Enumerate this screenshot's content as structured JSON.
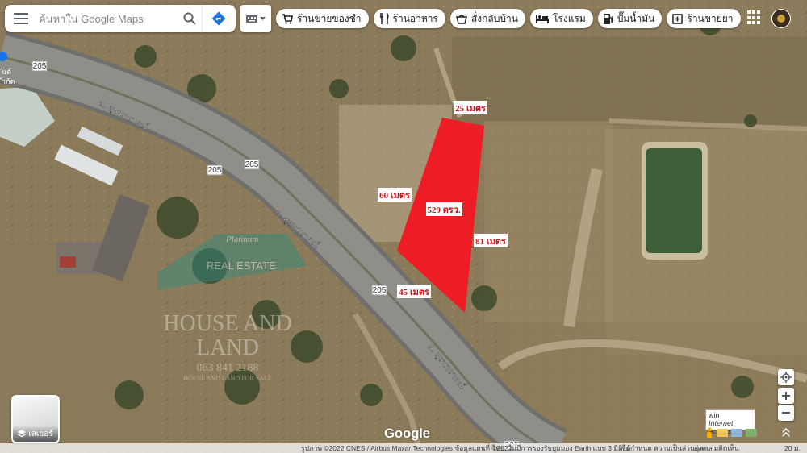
{
  "search": {
    "placeholder": "ค้นหาใน Google Maps"
  },
  "chips": [
    {
      "label": "ร้านขายของชำ",
      "icon": "cart-icon"
    },
    {
      "label": "ร้านอาหาร",
      "icon": "utensils-icon"
    },
    {
      "label": "สั่งกลับบ้าน",
      "icon": "takeout-icon"
    },
    {
      "label": "โรงแรม",
      "icon": "bed-icon"
    },
    {
      "label": "ปั๊มน้ำมัน",
      "icon": "gas-icon"
    },
    {
      "label": "ร้านขายยา",
      "icon": "pharmacy-icon"
    }
  ],
  "map": {
    "road_numbers": [
      "205",
      "205",
      "205",
      "205",
      "205"
    ],
    "road_names": [
      "ถ. สุรนารายณ์",
      "ถ. สุรนารายณ์",
      "ถ. สุรนารายณ์"
    ],
    "edge_labels": [
      "ันต์",
      "ำกัด"
    ],
    "plot": {
      "color": "#ee1c24",
      "area_label": "529 ตรว.",
      "top_side": "25 เมตร",
      "left_side": "60 เมตร",
      "right_side": "81 เมตร",
      "bottom_side": "45 เมตร"
    },
    "watermark": {
      "title": "Platinum",
      "sub": "REAL ESTATE",
      "line1": "HOUSE AND",
      "line2": "LAND",
      "phone": "063 841 2188",
      "tagline": "HOUSE AND LAND FOR SALE"
    }
  },
  "layers": {
    "label": "เลเยอร์"
  },
  "logo": "Google",
  "streetview": {
    "line1": "win",
    "line2": "Internet access"
  },
  "footer": {
    "imagery": "รูปภาพ ©2022 CNES / Airbus,Maxar Technologies,ข้อมูลแผนที่ ©2022",
    "country": "ไทย",
    "earth": "ไม่มีการรองรับบุมมอง Earth แบบ 3 มิติได้",
    "terms": "ข้อกำหนด",
    "privacy": "ความเป็นส่วนบุคคล",
    "feedback": "ส่งความคิดเห็น",
    "scale": "20 ม."
  }
}
